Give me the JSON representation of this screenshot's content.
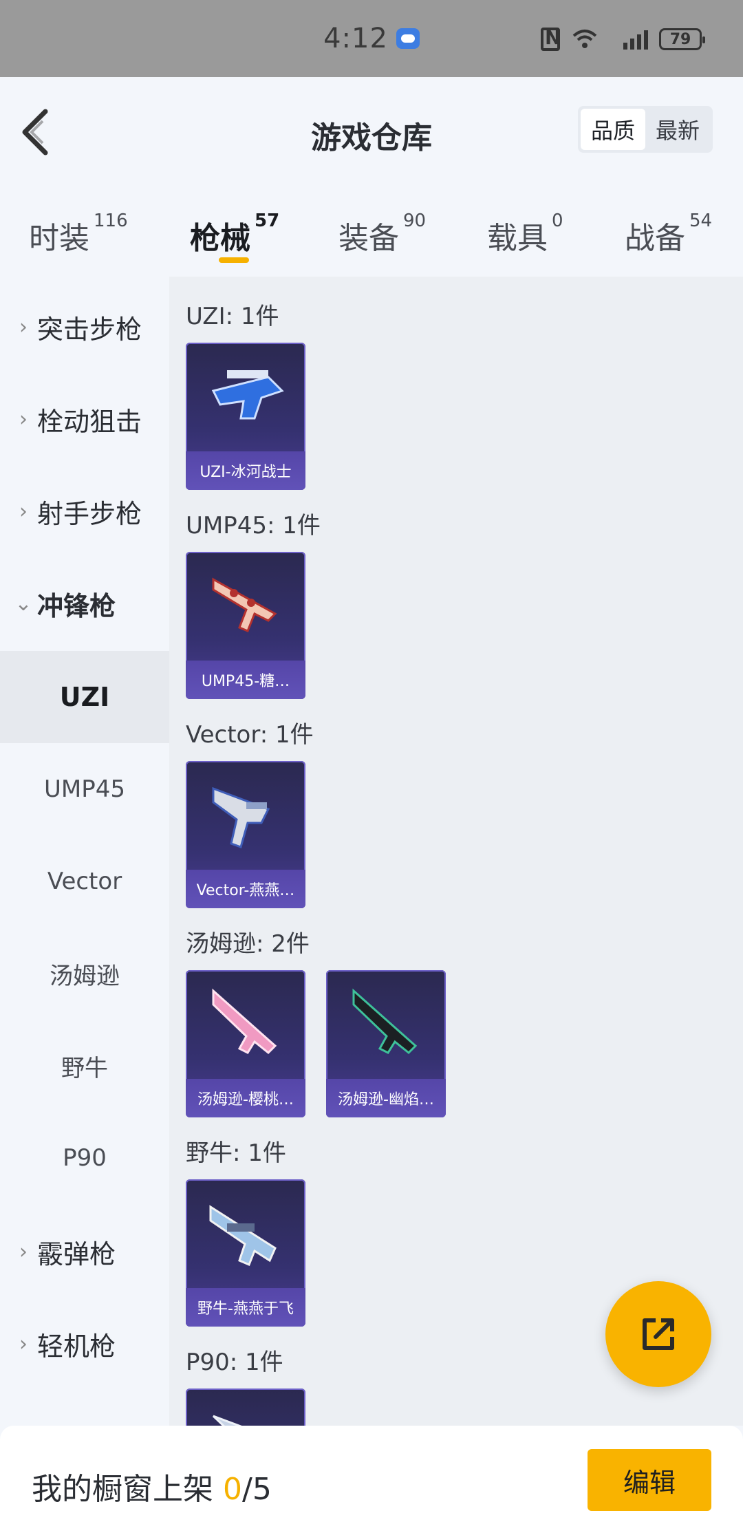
{
  "status": {
    "time": "4:12",
    "battery": "79"
  },
  "header": {
    "title": "游戏仓库",
    "sort_options": [
      "品质",
      "最新"
    ]
  },
  "tabs": [
    {
      "label": "时装",
      "count": "116"
    },
    {
      "label": "枪械",
      "count": "57"
    },
    {
      "label": "装备",
      "count": "90"
    },
    {
      "label": "载具",
      "count": "0"
    },
    {
      "label": "战备",
      "count": "54"
    }
  ],
  "sidebar": {
    "categories": [
      "突击步枪",
      "栓动狙击",
      "射手步枪",
      "冲锋枪",
      "霰弹枪",
      "轻机枪"
    ],
    "subitems": [
      "UZI",
      "UMP45",
      "Vector",
      "汤姆逊",
      "野牛",
      "P90"
    ]
  },
  "groups": [
    {
      "title": "UZI: 1件",
      "items": [
        "UZI-冰河战士"
      ]
    },
    {
      "title": "UMP45: 1件",
      "items": [
        "UMP45-糖…"
      ]
    },
    {
      "title": "Vector: 1件",
      "items": [
        "Vector-燕燕…"
      ]
    },
    {
      "title": "汤姆逊: 2件",
      "items": [
        "汤姆逊-樱桃…",
        "汤姆逊-幽焰…"
      ]
    },
    {
      "title": "野牛: 1件",
      "items": [
        "野牛-燕燕于飞"
      ]
    },
    {
      "title": "P90: 1件",
      "items": []
    }
  ],
  "bottom": {
    "label": "我的橱窗上架 ",
    "count": "0",
    "total": "/5",
    "edit_label": "编辑"
  },
  "colors": {
    "accent": "#f9b300",
    "card_bg": "#353170"
  }
}
